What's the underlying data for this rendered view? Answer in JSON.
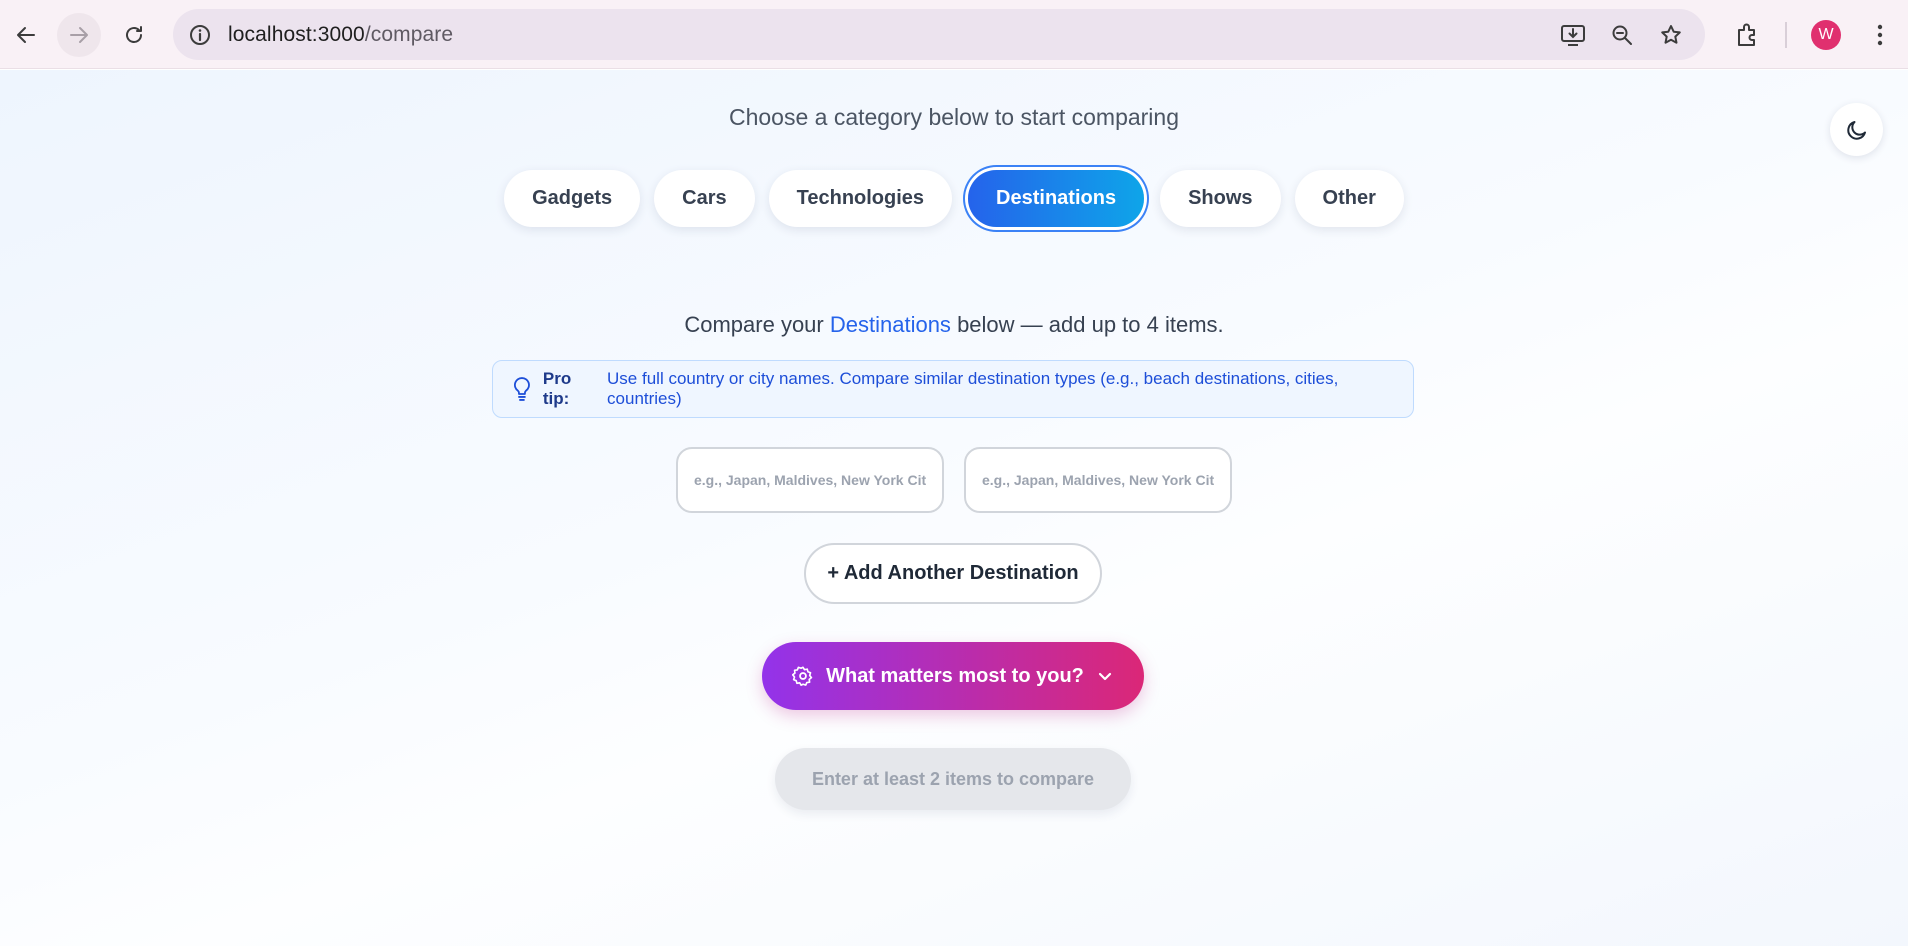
{
  "browser": {
    "url_host": "localhost:3000",
    "url_path": "/compare",
    "profile_initial": "W"
  },
  "page": {
    "subtitle": "Choose a category below to start comparing",
    "categories": [
      {
        "label": "Gadgets"
      },
      {
        "label": "Cars"
      },
      {
        "label": "Technologies"
      },
      {
        "label": "Destinations",
        "active": true
      },
      {
        "label": "Shows"
      },
      {
        "label": "Other"
      }
    ],
    "compare_prefix": "Compare your",
    "compare_category": "Destinations",
    "compare_suffix": "below — add up to 4 items.",
    "tip_label": "Pro tip:",
    "tip_text": "Use full country or city names. Compare similar destination types (e.g., beach destinations, cities, countries)",
    "inputs": [
      {
        "value": "",
        "placeholder": "e.g., Japan, Maldives, New York City"
      },
      {
        "value": "",
        "placeholder": "e.g., Japan, Maldives, New York City"
      }
    ],
    "add_button": "+ Add Another Destination",
    "priorities_button": "What matters most to you?",
    "submit_button": "Enter at least 2 items to compare"
  },
  "colors": {
    "accent_blue": "#2563eb",
    "gradient_purple": "#9333ea",
    "gradient_pink": "#db2777",
    "avatar": "#e0306f"
  },
  "icons": [
    "back-arrow-icon",
    "forward-arrow-icon",
    "reload-icon",
    "site-info-icon",
    "install-app-icon",
    "zoom-icon",
    "bookmark-star-icon",
    "extensions-icon",
    "menu-dots-icon",
    "moon-icon",
    "lightbulb-icon",
    "gear-icon",
    "chevron-down-icon"
  ]
}
